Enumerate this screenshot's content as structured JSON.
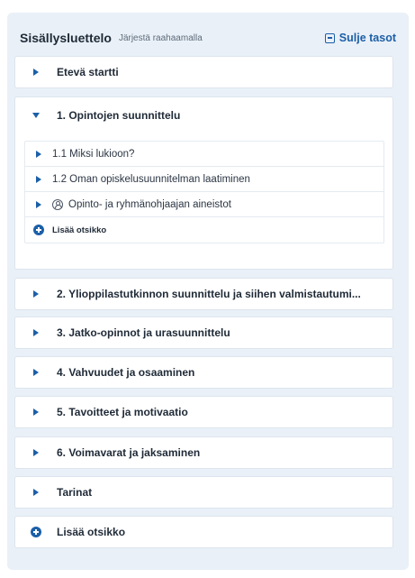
{
  "header": {
    "title": "Sisällysluettelo",
    "subtitle": "Järjestä raahaamalla",
    "collapse_label": "Sulje tasot"
  },
  "items": [
    {
      "label": "Etevä startti",
      "expanded": false
    },
    {
      "label": "1. Opintojen suunnittelu",
      "expanded": true
    },
    {
      "label": "2. Ylioppilastutkinnon suunnittelu ja siihen valmistautumi...",
      "expanded": false
    },
    {
      "label": "3. Jatko-opinnot ja urasuunnittelu",
      "expanded": false
    },
    {
      "label": "4. Vahvuudet ja osaaminen",
      "expanded": false
    },
    {
      "label": "5. Tavoitteet ja motivaatio",
      "expanded": false
    },
    {
      "label": "6. Voimavarat ja jaksaminen",
      "expanded": false
    },
    {
      "label": "Tarinat",
      "expanded": false
    }
  ],
  "subitems": [
    {
      "label": "1.1 Miksi lukioon?"
    },
    {
      "label": "1.2 Oman opiskelusuunnitelman laatiminen"
    },
    {
      "label": "Opinto- ja ryhmänohjaajan aineistot",
      "icon": "person-icon"
    }
  ],
  "sub_add_label": "Lisää otsikko",
  "add_label": "Lisää otsikko",
  "colors": {
    "accent": "#1c5fa8",
    "panel_bg": "#e9f0f7"
  }
}
